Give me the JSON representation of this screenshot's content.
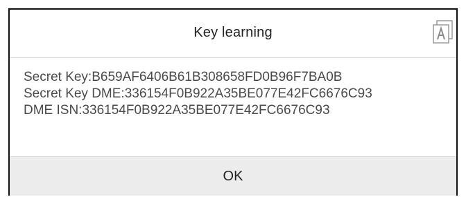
{
  "dialog": {
    "title": "Key learning",
    "lines": [
      "Secret Key:B659AF6406B61B308658FD0B96F7BA0B",
      "Secret Key DME:336154F0B922A35BE077E42FC6676C93",
      "DME ISN:336154F0B922A35BE077E42FC6676C93"
    ],
    "ok_label": "OK",
    "corner_icon": "translate-icon"
  },
  "colors": {
    "border": "#111111",
    "footer_bg": "#ececec",
    "text": "#4a4a4a",
    "title_text": "#222222"
  }
}
